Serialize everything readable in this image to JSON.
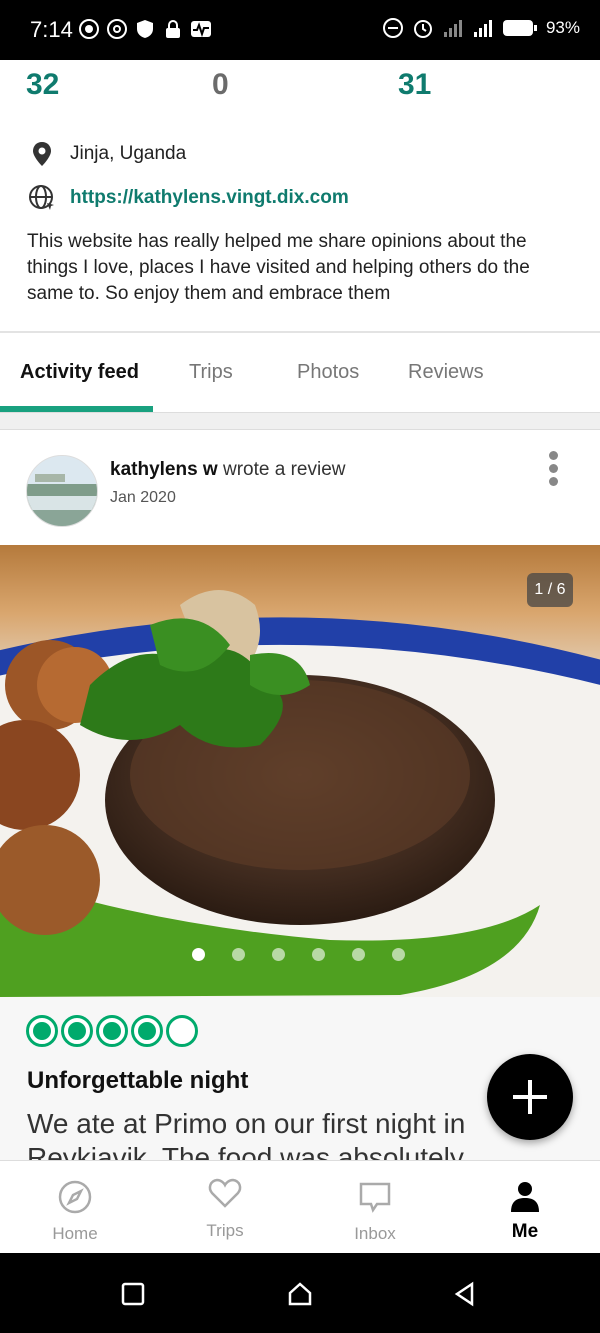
{
  "status_bar": {
    "time": "7:14",
    "battery": "93%"
  },
  "stats": {
    "first": "32",
    "second": "0",
    "third": "31"
  },
  "profile": {
    "location": "Jinja, Uganda",
    "website": "https://kathylens.vingt.dix.com",
    "bio": "This website has really helped me share opinions about the things I love, places I have visited and helping others do the same to. So enjoy them and embrace them"
  },
  "tabs": [
    {
      "label": "Activity feed"
    },
    {
      "label": "Trips"
    },
    {
      "label": "Photos"
    },
    {
      "label": "Reviews"
    }
  ],
  "post": {
    "author": "kathylens w",
    "action": "wrote a review",
    "date": "Jan 2020",
    "photo_counter": "1 / 6",
    "photo_count": 6,
    "photo_index": 1
  },
  "review": {
    "rating": 4,
    "rating_max": 5,
    "title": "Unforgettable night",
    "body": "We ate at Primo on our first night in Reykjavik. The food was absolutely"
  },
  "bottom_nav": [
    {
      "label": "Home",
      "icon": "compass-icon"
    },
    {
      "label": "Trips",
      "icon": "heart-icon"
    },
    {
      "label": "Inbox",
      "icon": "chat-icon"
    },
    {
      "label": "Me",
      "icon": "person-icon"
    }
  ],
  "colors": {
    "accent": "#0f7b6e",
    "bubble": "#00aa6c",
    "tab_underline": "#19a17f"
  }
}
